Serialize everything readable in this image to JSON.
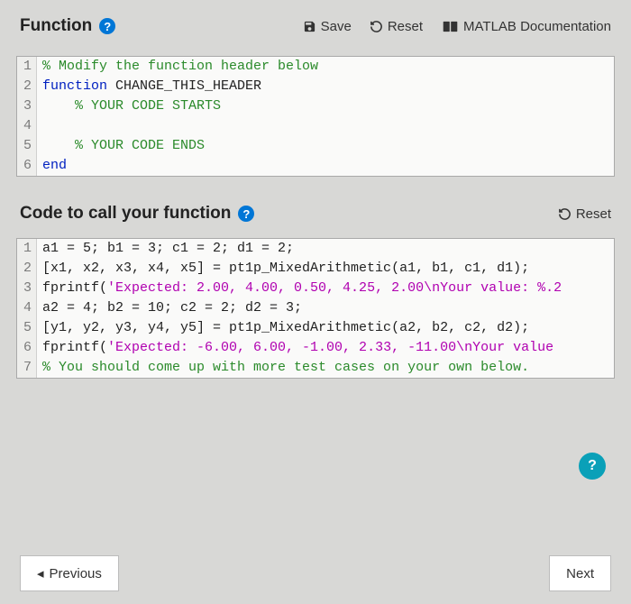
{
  "header": {
    "title": "Function",
    "save_label": "Save",
    "reset_label": "Reset",
    "matlab_doc_label": "MATLAB Documentation"
  },
  "editor1": {
    "lines": [
      {
        "n": "1",
        "seg": [
          {
            "cls": "c-comment",
            "t": "% Modify the function header below"
          }
        ]
      },
      {
        "n": "2",
        "seg": [
          {
            "cls": "c-keyword",
            "t": "function"
          },
          {
            "cls": "",
            "t": " CHANGE_THIS_HEADER"
          }
        ]
      },
      {
        "n": "3",
        "seg": [
          {
            "cls": "",
            "t": "    "
          },
          {
            "cls": "c-comment",
            "t": "% YOUR CODE STARTS"
          }
        ]
      },
      {
        "n": "4",
        "seg": [
          {
            "cls": "",
            "t": " "
          }
        ]
      },
      {
        "n": "5",
        "seg": [
          {
            "cls": "",
            "t": "    "
          },
          {
            "cls": "c-comment",
            "t": "% YOUR CODE ENDS"
          }
        ]
      },
      {
        "n": "6",
        "seg": [
          {
            "cls": "c-keyword",
            "t": "end"
          }
        ]
      }
    ]
  },
  "subheader": {
    "title": "Code to call your function",
    "reset_label": "Reset"
  },
  "editor2": {
    "lines": [
      {
        "n": "1",
        "seg": [
          {
            "cls": "",
            "t": "a1 = 5; b1 = 3; c1 = 2; d1 = 2;"
          }
        ]
      },
      {
        "n": "2",
        "seg": [
          {
            "cls": "",
            "t": "[x1, x2, x3, x4, x5] = pt1p_MixedArithmetic(a1, b1, c1, d1);"
          }
        ]
      },
      {
        "n": "3",
        "seg": [
          {
            "cls": "",
            "t": "fprintf("
          },
          {
            "cls": "c-string",
            "t": "'Expected: 2.00, 4.00, 0.50, 4.25, 2.00\\nYour value: %.2"
          }
        ]
      },
      {
        "n": "4",
        "seg": [
          {
            "cls": "",
            "t": "a2 = 4; b2 = 10; c2 = 2; d2 = 3;"
          }
        ]
      },
      {
        "n": "5",
        "seg": [
          {
            "cls": "",
            "t": "[y1, y2, y3, y4, y5] = pt1p_MixedArithmetic(a2, b2, c2, d2);"
          }
        ]
      },
      {
        "n": "6",
        "seg": [
          {
            "cls": "",
            "t": "fprintf("
          },
          {
            "cls": "c-string",
            "t": "'Expected: -6.00, 6.00, -1.00, 2.33, -11.00\\nYour value"
          }
        ]
      },
      {
        "n": "7",
        "seg": [
          {
            "cls": "c-comment",
            "t": "% You should come up with more test cases on your own below."
          }
        ]
      }
    ]
  },
  "chat_badge": "?",
  "nav": {
    "prev": "Previous",
    "next": "Next"
  }
}
